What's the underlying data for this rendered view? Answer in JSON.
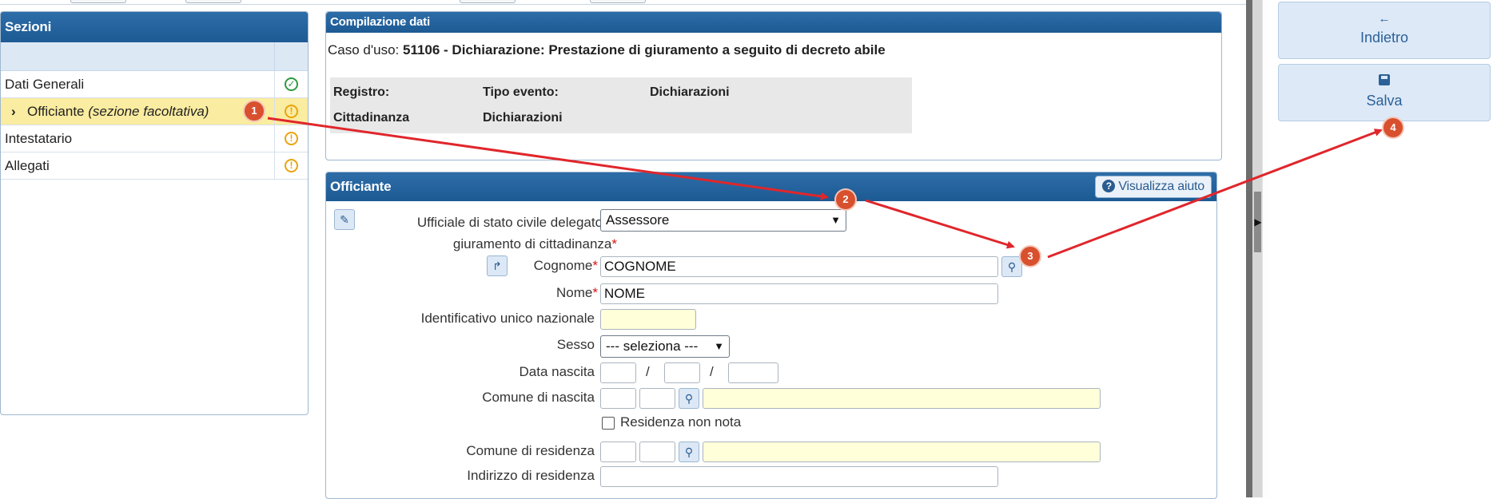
{
  "sections_panel": {
    "title": "Sezioni",
    "items": [
      {
        "label": "Dati Generali",
        "status": "ok"
      },
      {
        "label": "Officiante",
        "suffix": "(sezione facoltativa)",
        "status": "warning",
        "active": true
      },
      {
        "label": "Intestatario",
        "status": "warning"
      },
      {
        "label": "Allegati",
        "status": "warning"
      }
    ]
  },
  "compilazione": {
    "title": "Compilazione dati",
    "caso_label": "Caso d'uso:",
    "caso_value": "51106 - Dichiarazione: Prestazione di giuramento a seguito di decreto abile",
    "registro_label": "Registro:",
    "registro_value": "Cittadinanza",
    "tipo_evento_label": "Tipo evento:",
    "tipo_evento_value": "Dichiarazioni",
    "tipo_evento_value2": "Dichiarazioni"
  },
  "officiante": {
    "title": "Officiante",
    "help_button": "Visualizza aiuto",
    "ufficiale_label_line1": "Ufficiale di stato civile delegato al",
    "ufficiale_label_line2": "giuramento di cittadinanza",
    "ufficiale_value": "Assessore",
    "cognome_label": "Cognome",
    "cognome_value": "COGNOME",
    "nome_label": "Nome",
    "nome_value": "NOME",
    "identificativo_label": "Identificativo unico nazionale",
    "identificativo_value": "",
    "sesso_label": "Sesso",
    "sesso_value": "--- seleziona ---",
    "data_nascita_label": "Data nascita",
    "date_separator": "/",
    "comune_nascita_label": "Comune di nascita",
    "residenza_non_nota_label": "Residenza non nota",
    "comune_residenza_label": "Comune di residenza",
    "indirizzo_residenza_label": "Indirizzo di residenza",
    "required_mark": "*"
  },
  "actions": {
    "back_icon": "←",
    "back_label": "Indietro",
    "save_label": "Salva"
  },
  "annotations": [
    "1",
    "2",
    "3",
    "4"
  ],
  "colors": {
    "header_blue": "#1d5a94",
    "active_row": "#faeca0",
    "annotation_red": "#e0262b",
    "badge": "#d8502e"
  }
}
